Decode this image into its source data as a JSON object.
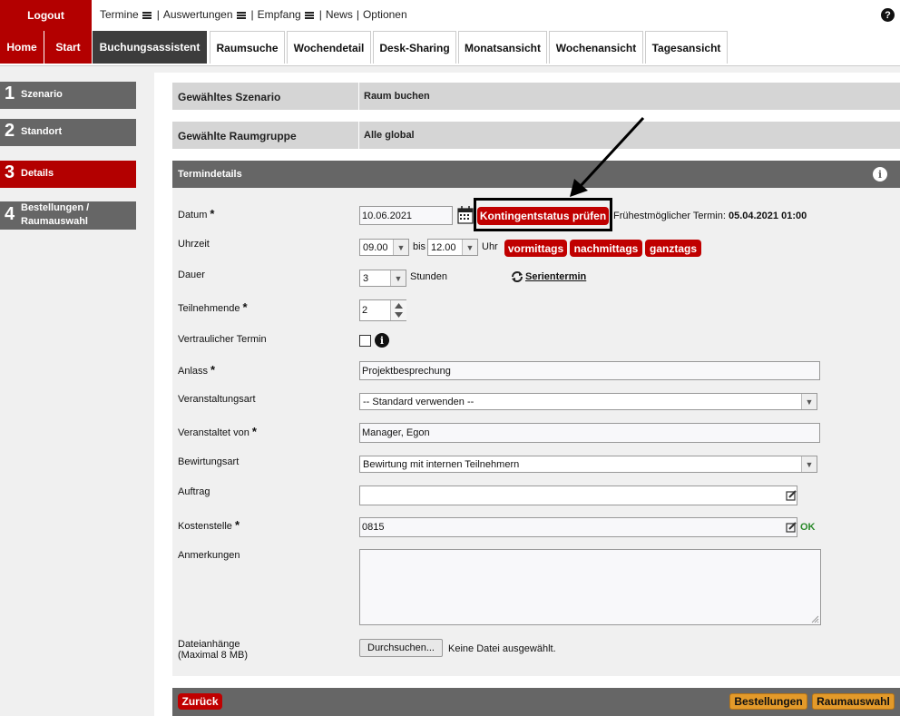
{
  "topbar": {
    "logout": "Logout",
    "menu": [
      "Termine",
      "Auswertungen",
      "Empfang",
      "News",
      "Optionen"
    ],
    "separator": "|",
    "help": "?"
  },
  "nav": {
    "tabs": [
      "Home",
      "Start",
      "Buchungsassistent",
      "Raumsuche",
      "Wochendetail",
      "Desk-Sharing",
      "Monatsansicht",
      "Wochenansicht",
      "Tagesansicht"
    ]
  },
  "sidebar": {
    "steps": [
      {
        "num": "1",
        "label": "Szenario"
      },
      {
        "num": "2",
        "label": "Standort"
      },
      {
        "num": "3",
        "label": "Details"
      },
      {
        "num": "4",
        "label": "Bestellungen /",
        "label2": "Raumauswahl"
      }
    ]
  },
  "summary": {
    "scenario_label": "Gewähltes Szenario",
    "scenario_value": "Raum buchen",
    "group_label": "Gewählte Raumgruppe",
    "group_value": "Alle global"
  },
  "termin": {
    "header": "Termindetails",
    "info": "i"
  },
  "form": {
    "datum_label": "Datum",
    "datum_value": "10.06.2021",
    "kontingent_button": "Kontingentstatus prüfen",
    "earliest_label": "Frühestmöglicher Termin:",
    "earliest_value": "05.04.2021 01:00",
    "uhrzeit_label": "Uhrzeit",
    "from_value": "09.00",
    "bis": "bis",
    "to_value": "12.00",
    "uhr": "Uhr",
    "vormittags": "vormittags",
    "nachmittags": "nachmittags",
    "ganztags": "ganztags",
    "dauer_label": "Dauer",
    "dauer_value": "3",
    "stunden": "Stunden",
    "serientermin": "Serientermin",
    "teilnehmende_label": "Teilnehmende",
    "teilnehmende_value": "2",
    "vertraulich_label": "Vertraulicher Termin",
    "anlass_label": "Anlass",
    "anlass_value": "Projektbesprechung",
    "veranstaltungsart_label": "Veranstaltungsart",
    "veranstaltungsart_value": "-- Standard verwenden --",
    "veranstaltet_label": "Veranstaltet von",
    "veranstaltet_value": "Manager, Egon",
    "bewirtung_label": "Bewirtungsart",
    "bewirtung_value": "Bewirtung mit internen Teilnehmern",
    "auftrag_label": "Auftrag",
    "auftrag_value": "",
    "kostenstelle_label": "Kostenstelle",
    "kostenstelle_value": "0815",
    "ok": "OK",
    "anmerkungen_label": "Anmerkungen",
    "anhaenge_label": "Dateianhänge",
    "anhaenge_sub": "(Maximal 8 MB)",
    "browse_button": "Durchsuchen...",
    "no_file": "Keine Datei ausgewählt.",
    "required_star": "*"
  },
  "footer": {
    "back": "Zurück",
    "bestellungen": "Bestellungen",
    "raumauswahl": "Raumauswahl"
  },
  "colors": {
    "brand_red": "#b30000",
    "button_red": "#c00000",
    "orange": "#e39a2a",
    "ok_green": "#2a8a2a"
  }
}
